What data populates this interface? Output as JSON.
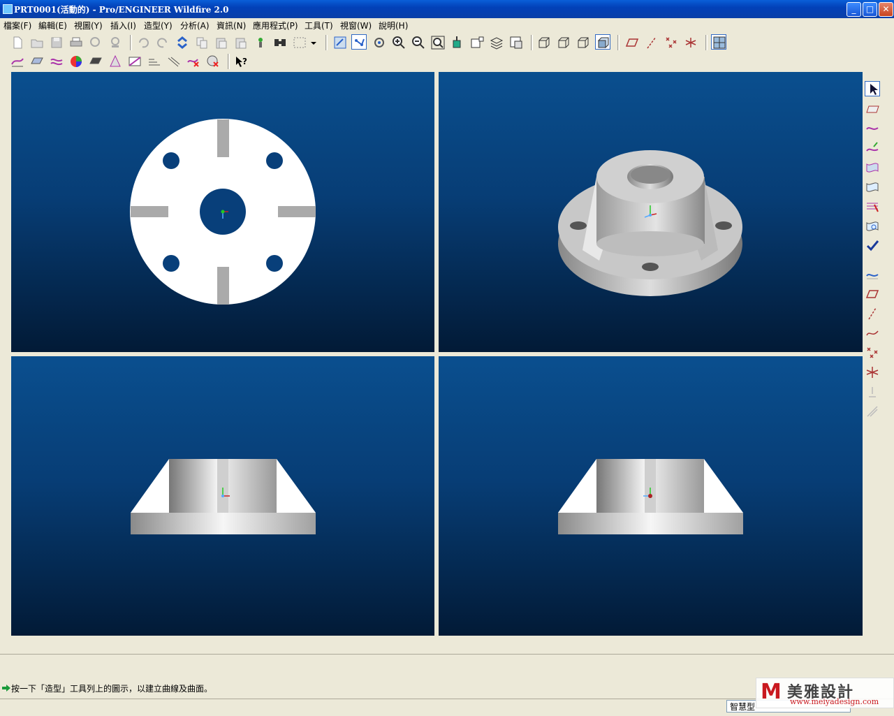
{
  "window": {
    "title": "PRT0001(活動的) - Pro/ENGINEER Wildfire 2.0",
    "minimize": "_",
    "maximize": "□",
    "close": "✕"
  },
  "menu": [
    "檔案(F)",
    "編輯(E)",
    "視圖(Y)",
    "插入(I)",
    "造型(Y)",
    "分析(A)",
    "資訊(N)",
    "應用程式(P)",
    "工具(T)",
    "視窗(W)",
    "說明(H)"
  ],
  "toolbar_row1": [
    "new-icon",
    "open-icon",
    "save-icon",
    "print-icon",
    "print-preview-icon",
    "send-icon",
    "undo-icon",
    "redo-icon",
    "regenerate-icon",
    "copy-icon",
    "paste-icon",
    "paste-special-icon",
    "model-tree-icon",
    "find-icon",
    "select-box-icon",
    "dropdown-arrow-icon",
    "repaint-icon",
    "spin-center-icon",
    "orient-icon",
    "zoom-in-icon",
    "zoom-out-icon",
    "refit-icon",
    "view-manager-icon",
    "saved-views-icon",
    "layers-icon",
    "model-display-icon",
    "wireframe-icon",
    "hidden-line-icon",
    "no-hidden-icon",
    "shading-icon",
    "datum-planes-icon",
    "datum-axes-icon",
    "datum-points-icon",
    "coordinate-systems-icon",
    "style-view-icon"
  ],
  "toolbar_row2": [
    "curve-analysis-icon",
    "surface-analysis-icon",
    "reflection-icon",
    "curvature-icon",
    "shade-analysis-icon",
    "draft-analysis-icon",
    "slope-icon",
    "section-icon",
    "offset-icon",
    "deviation-icon",
    "connection-icon",
    "whats-this-icon"
  ],
  "right_toolbar": [
    "select-icon",
    "internal-plane-icon",
    "create-curve-icon",
    "curve-from-surface-icon",
    "boundary-surface-icon",
    "surface-icon",
    "trim-icon",
    "surface-edit-icon",
    "done-check-icon",
    "curve-edit-icon",
    "datum-plane-icon",
    "datum-axis-icon",
    "datum-curve-icon",
    "datum-point-icon",
    "offset-point-icon",
    "field-point-icon",
    "coordinate-icon"
  ],
  "message": "按一下「造型」工具列上的圖示，以建立曲線及曲面。",
  "filter": "智慧型",
  "watermark": {
    "mark": "M",
    "name": "美雅設計",
    "url": "www.meiyadesign.com"
  },
  "colors": {
    "viewport_top": "#0a4f8f",
    "viewport_bottom": "#021a36",
    "model_face": "#ffffff",
    "model_shade": "#b9b9b9"
  }
}
